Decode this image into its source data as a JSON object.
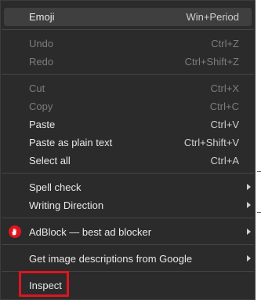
{
  "menu": {
    "emoji": {
      "label": "Emoji",
      "shortcut": "Win+Period"
    },
    "undo": {
      "label": "Undo",
      "shortcut": "Ctrl+Z"
    },
    "redo": {
      "label": "Redo",
      "shortcut": "Ctrl+Shift+Z"
    },
    "cut": {
      "label": "Cut",
      "shortcut": "Ctrl+X"
    },
    "copy": {
      "label": "Copy",
      "shortcut": "Ctrl+C"
    },
    "paste": {
      "label": "Paste",
      "shortcut": "Ctrl+V"
    },
    "paste_plain": {
      "label": "Paste as plain text",
      "shortcut": "Ctrl+Shift+V"
    },
    "select_all": {
      "label": "Select all",
      "shortcut": "Ctrl+A"
    },
    "spell_check": {
      "label": "Spell check"
    },
    "writing_direction": {
      "label": "Writing Direction"
    },
    "adblock": {
      "label": "AdBlock — best ad blocker",
      "icon": "adblock-hand-icon"
    },
    "image_descriptions": {
      "label": "Get image descriptions from Google"
    },
    "inspect": {
      "label": "Inspect"
    }
  },
  "colors": {
    "menu_background": "#2b2b2b",
    "highlight": "#3f3f3f",
    "text": "#e8e8e8",
    "disabled_text": "#7d7d7d",
    "inspect_outline": "#e0141e",
    "adblock_red": "#e0141e"
  }
}
